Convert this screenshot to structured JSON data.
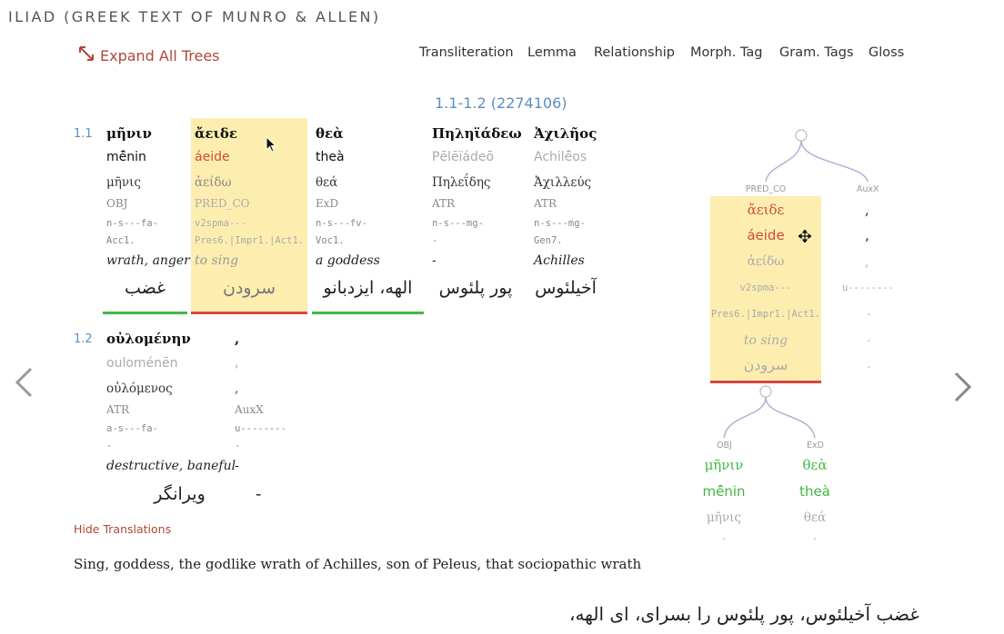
{
  "title": "ILIAD (GREEK TEXT OF MUNRO & ALLEN)",
  "toolbar": {
    "expand_label": "Expand All Trees",
    "links": [
      "Transliteration",
      "Lemma",
      "Relationship",
      "Morph. Tag",
      "Gram. Tags",
      "Gloss"
    ]
  },
  "reference": "1.1-1.2 (2274106)",
  "verses": [
    {
      "num": "1.1",
      "words": [
        {
          "greek": "μῆνιν",
          "translit": "mē̂nin",
          "lemma": "μῆνις",
          "rel": "OBJ",
          "morph": "n-s---fa-",
          "gram": "Acc1.",
          "gloss": "wrath, anger",
          "persian": "غضب"
        },
        {
          "greek": "ἄειδε",
          "translit": "áeide",
          "lemma": "ἀείδω",
          "rel": "PRED_CO",
          "morph": "v2spma---",
          "gram": "Pres6.|Impr1.|Act1.",
          "gloss": "to sing",
          "persian": "سرودن"
        },
        {
          "greek": "θεὰ",
          "translit": "theà",
          "lemma": "θεά",
          "rel": "ExD",
          "morph": "n-s---fv-",
          "gram": "Voc1.",
          "gloss": "a goddess",
          "persian": "الهه، ایزدبانو"
        },
        {
          "greek": "Πηληϊάδεω",
          "translit": "Pēlēïádeō",
          "lemma": "Πηλεΐδης",
          "rel": "ATR",
          "morph": "n-s---mg-",
          "gram": "-",
          "gloss": "-",
          "persian": "پور پلئوس"
        },
        {
          "greek": "Ἀχιλῆος",
          "translit": "Achilē̂os",
          "lemma": "Ἀχιλλεύς",
          "rel": "ATR",
          "morph": "n-s---mg-",
          "gram": "Gen7.",
          "gloss": "Achilles",
          "persian": "آخیلئوس"
        }
      ]
    },
    {
      "num": "1.2",
      "words": [
        {
          "greek": "οὐλομένην",
          "translit": "ouloménēn",
          "lemma": "οὐλόμενος",
          "rel": "ATR",
          "morph": "a-s---fa-",
          "gram": "-",
          "gloss": "destructive, baneful",
          "persian": "ویرانگر"
        },
        {
          "greek": ",",
          "translit": ",",
          "lemma": ",",
          "rel": "AuxX",
          "morph": "u--------",
          "gram": "-",
          "gloss": "-",
          "persian": "-"
        }
      ]
    }
  ],
  "hide_translations": "Hide Translations",
  "translation_en": "Sing, goddess, the godlike wrath of Achilles, son of Peleus, that sociopathic wrath",
  "translation_fa": "غضب آخیلئوس، پور پلئوس را بسرای، ای الهه،",
  "tree": {
    "top_rels": [
      "PRED_CO",
      "AuxX"
    ],
    "head": {
      "greek": "ἄειδε",
      "translit": "áeide",
      "lemma": "ἀείδω",
      "morph": "v2spma---",
      "gram": "Pres6.|Impr1.|Act1.",
      "gloss": "to sing",
      "persian": "سرودن"
    },
    "side": {
      "greek": ",",
      "translit": ",",
      "lemma": ",",
      "morph": "u--------",
      "gram": "-",
      "gloss": "-",
      "persian": "-"
    },
    "children": [
      {
        "rel": "OBJ",
        "greek": "μῆνιν",
        "translit": "mē̂nin",
        "lemma": "μῆνις",
        "morph": "-"
      },
      {
        "rel": "ExD",
        "greek": "θεὰ",
        "translit": "theà",
        "lemma": "θεά",
        "morph": "-"
      }
    ]
  },
  "colors": {
    "accent_red": "#d04a3e",
    "link_blue": "#5b8fc0",
    "highlight": "#fdeeb0",
    "green": "#44b744"
  },
  "icons": {
    "expand": "expand-arrows-icon",
    "prev": "chevron-left-icon",
    "next": "chevron-right-icon",
    "move": "move-cursor-icon"
  }
}
